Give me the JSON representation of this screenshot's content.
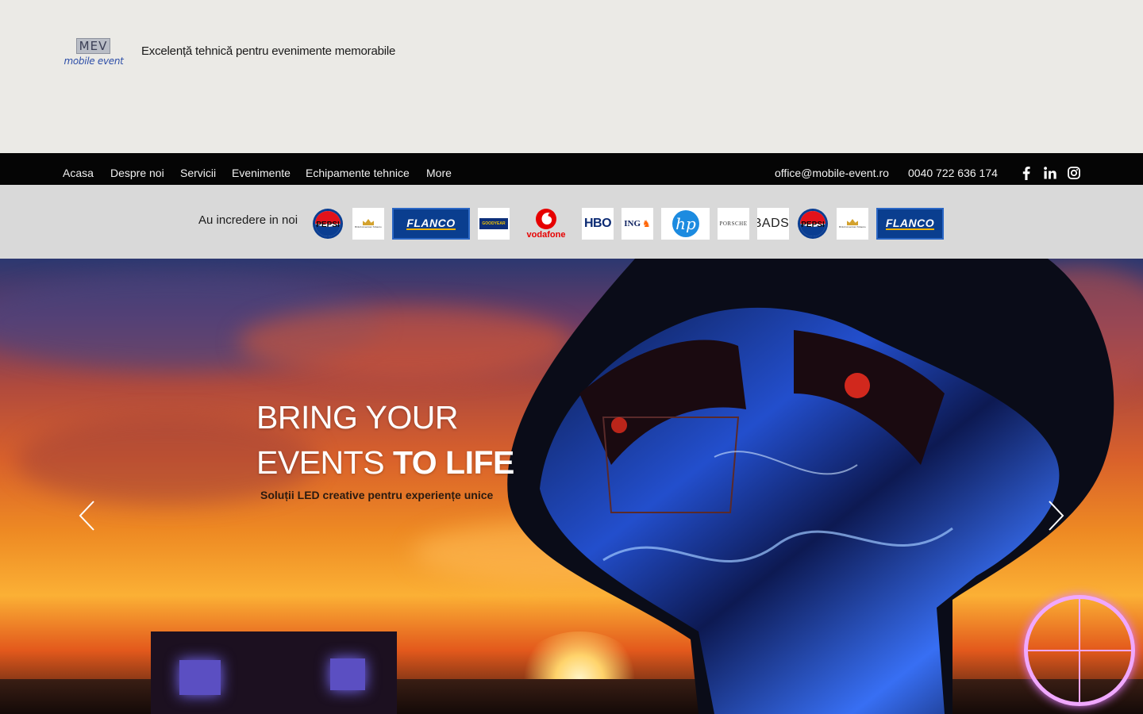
{
  "header": {
    "logo_mark": "MEV",
    "logo_sub": "mobile event",
    "tagline": "Excelență tehnică pentru evenimente memorabile"
  },
  "nav": {
    "items": [
      {
        "label": "Acasa"
      },
      {
        "label": "Despre noi"
      },
      {
        "label": "Servicii"
      },
      {
        "label": "Evenimente"
      },
      {
        "label": "Echipamente tehnice"
      },
      {
        "label": "More"
      }
    ],
    "email": "office@mobile-event.ro",
    "phone": "0040 722 636 174",
    "social": [
      "facebook-icon",
      "linkedin-icon",
      "instagram-icon"
    ]
  },
  "trust": {
    "label": "Au incredere in noi",
    "brands": [
      {
        "name": "PEPSI"
      },
      {
        "name": "British American Tobacco"
      },
      {
        "name": "FLANCO"
      },
      {
        "name": "GOODYEAR"
      },
      {
        "name": "vodafone"
      },
      {
        "name": "HBO"
      },
      {
        "name": "ING"
      },
      {
        "name": "hp"
      },
      {
        "name": "PORSCHE"
      },
      {
        "name": "BADSI"
      },
      {
        "name": "PEPSI"
      },
      {
        "name": "British American Tobacco"
      },
      {
        "name": "FLANCO"
      }
    ]
  },
  "hero": {
    "title_line1": "BRING YOUR",
    "title_line2_a": "EVENTS ",
    "title_line2_b": "TO LIFE",
    "subtitle": "Soluții LED creative pentru experiențe unice",
    "colors": {
      "sky_top": "#2c3870",
      "sky_mid": "#d9612b",
      "sky_glow": "#fbb035",
      "led_blue": "#2452d6"
    }
  },
  "colors": {
    "header_bg": "#ebeae6",
    "nav_bg": "#050505",
    "trust_bg": "#d9d9d9",
    "nav_text": "#f1f1f1"
  }
}
